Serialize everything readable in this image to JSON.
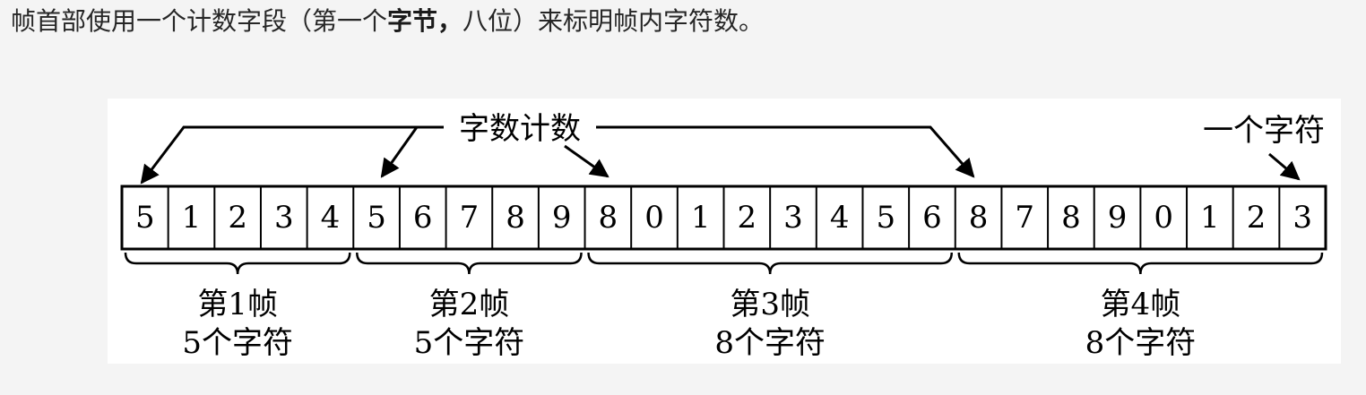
{
  "intro": {
    "before": "帧首部使用一个计数字段（第一个",
    "bold": "字节，",
    "after": "八位）来标明帧内字符数。"
  },
  "diagram": {
    "count_label": "字数计数",
    "char_label": "一个字符",
    "cells": [
      "5",
      "1",
      "2",
      "3",
      "4",
      "5",
      "6",
      "7",
      "8",
      "9",
      "8",
      "0",
      "1",
      "2",
      "3",
      "4",
      "5",
      "6",
      "8",
      "7",
      "8",
      "9",
      "0",
      "1",
      "2",
      "3"
    ],
    "frames": [
      {
        "title": "第1帧",
        "desc": "5个字符",
        "start": 0,
        "count": 5
      },
      {
        "title": "第2帧",
        "desc": "5个字符",
        "start": 5,
        "count": 5
      },
      {
        "title": "第3帧",
        "desc": "8个字符",
        "start": 10,
        "count": 8
      },
      {
        "title": "第4帧",
        "desc": "8个字符",
        "start": 18,
        "count": 8
      }
    ]
  }
}
